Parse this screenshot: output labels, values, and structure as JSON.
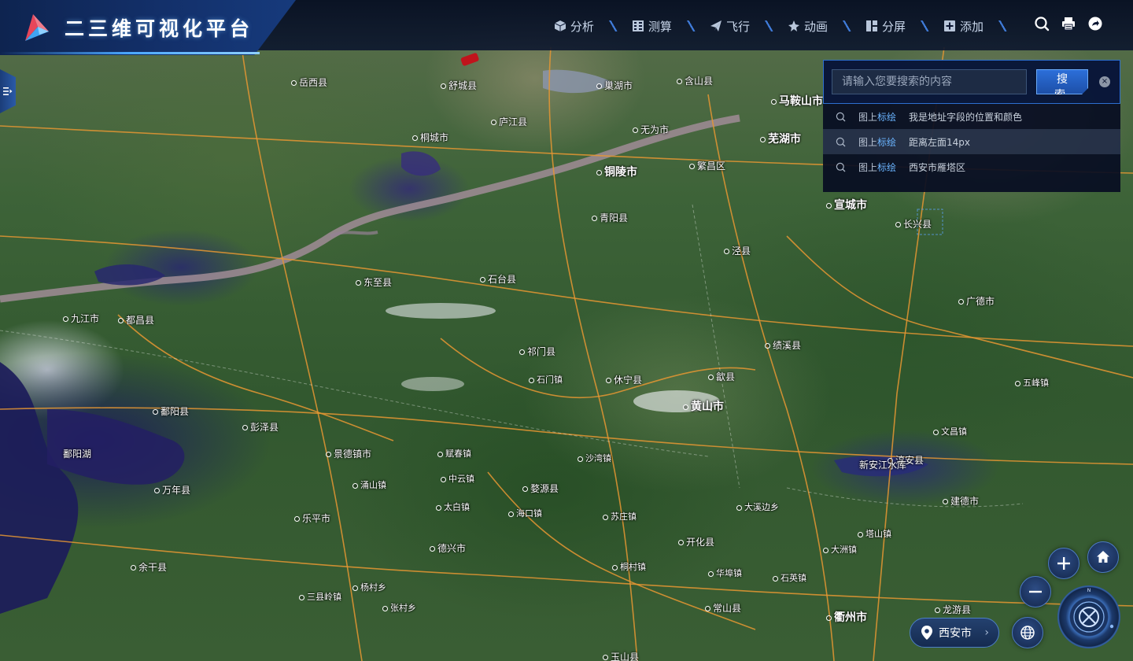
{
  "header": {
    "title": "二三维可视化平台",
    "nav": [
      {
        "label": "分析",
        "icon": "cube-icon"
      },
      {
        "label": "测算",
        "icon": "calculator-icon"
      },
      {
        "label": "飞行",
        "icon": "paper-plane-icon"
      },
      {
        "label": "动画",
        "icon": "sparkle-icon"
      },
      {
        "label": "分屏",
        "icon": "split-screen-icon"
      },
      {
        "label": "添加",
        "icon": "plus-square-icon"
      }
    ],
    "tools": [
      "search-icon",
      "print-icon",
      "share-icon"
    ]
  },
  "search": {
    "placeholder": "请输入您要搜索的内容",
    "button_label": "搜 索",
    "results": [
      {
        "prefix": "图上",
        "keyword": "标绘",
        "text": "我是地址字段的位置和颜色"
      },
      {
        "prefix": "图上",
        "keyword": "标绘",
        "text": "距离左面14px"
      },
      {
        "prefix": "图上",
        "keyword": "标绘",
        "text": "西安市雁塔区"
      }
    ]
  },
  "location": {
    "label": "西安市"
  },
  "compass": {
    "north_label": "N"
  },
  "map": {
    "labels": [
      {
        "name": "芜湖市",
        "size": "big"
      },
      {
        "name": "铜陵市",
        "size": "big"
      },
      {
        "name": "马鞍山市",
        "size": "big"
      },
      {
        "name": "宣城市",
        "size": "big"
      },
      {
        "name": "长兴县",
        "size": "city"
      },
      {
        "name": "桐城市",
        "size": "city"
      },
      {
        "name": "庐江县",
        "size": "city"
      },
      {
        "name": "无为市",
        "size": "city"
      },
      {
        "name": "繁昌区",
        "size": "city"
      },
      {
        "name": "巢湖市",
        "size": "city"
      },
      {
        "name": "含山县",
        "size": "city"
      },
      {
        "name": "舒城县",
        "size": "city"
      },
      {
        "name": "岳西县",
        "size": "city"
      },
      {
        "name": "九江市",
        "size": "city"
      },
      {
        "name": "东至县",
        "size": "city"
      },
      {
        "name": "石台县",
        "size": "city"
      },
      {
        "name": "黄山市",
        "size": "big"
      },
      {
        "name": "景德镇市",
        "size": "city"
      },
      {
        "name": "婺源县",
        "size": "city"
      },
      {
        "name": "鄱阳湖",
        "size": "city"
      },
      {
        "name": "德兴市",
        "size": "city"
      },
      {
        "name": "开化县",
        "size": "city"
      },
      {
        "name": "常山县",
        "size": "city"
      },
      {
        "name": "衢州市",
        "size": "big"
      },
      {
        "name": "龙游县",
        "size": "city"
      },
      {
        "name": "淳安县",
        "size": "city"
      },
      {
        "name": "新安江水库",
        "size": "city"
      },
      {
        "name": "建德市",
        "size": "city"
      },
      {
        "name": "乐平市",
        "size": "city"
      },
      {
        "name": "万年县",
        "size": "city"
      },
      {
        "name": "余干县",
        "size": "city"
      },
      {
        "name": "鄱阳县",
        "size": "city"
      },
      {
        "name": "都昌县",
        "size": "city"
      },
      {
        "name": "彭泽县",
        "size": "city"
      },
      {
        "name": "祁门县",
        "size": "city"
      },
      {
        "name": "休宁县",
        "size": "city"
      },
      {
        "name": "歙县",
        "size": "city"
      },
      {
        "name": "绩溪县",
        "size": "city"
      },
      {
        "name": "泾县",
        "size": "city"
      },
      {
        "name": "青阳县",
        "size": "city"
      },
      {
        "name": "广德市",
        "size": "city"
      },
      {
        "name": "玉山县",
        "size": "city"
      },
      {
        "name": "太白镇",
        "size": "small"
      },
      {
        "name": "海口镇",
        "size": "small"
      },
      {
        "name": "苏庄镇",
        "size": "small"
      },
      {
        "name": "杨村乡",
        "size": "small"
      },
      {
        "name": "沙湾镇",
        "size": "small"
      },
      {
        "name": "中云镇",
        "size": "small"
      },
      {
        "name": "涌山镇",
        "size": "small"
      },
      {
        "name": "赋春镇",
        "size": "small"
      },
      {
        "name": "石门镇",
        "size": "small"
      },
      {
        "name": "大溪边乡",
        "size": "small"
      },
      {
        "name": "桐村镇",
        "size": "small"
      },
      {
        "name": "华埠镇",
        "size": "small"
      },
      {
        "name": "石英镇",
        "size": "small"
      },
      {
        "name": "三县岭镇",
        "size": "small"
      },
      {
        "name": "张村乡",
        "size": "small"
      },
      {
        "name": "塔山镇",
        "size": "small"
      },
      {
        "name": "五峰镇",
        "size": "small"
      },
      {
        "name": "大洲镇",
        "size": "small"
      },
      {
        "name": "文昌镇",
        "size": "small"
      }
    ]
  }
}
